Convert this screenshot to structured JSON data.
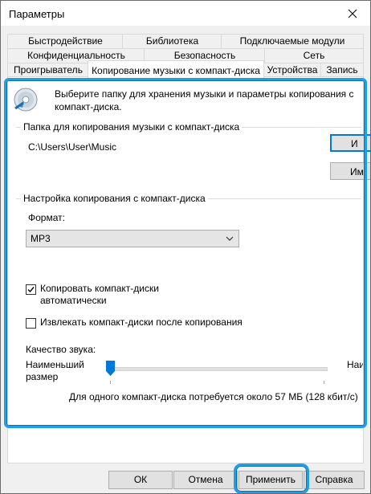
{
  "window": {
    "title": "Параметры"
  },
  "tabs": {
    "row1": [
      "Быстродействие",
      "Библиотека",
      "Подключаемые модули"
    ],
    "row2": [
      "Конфиденциальность",
      "Безопасность",
      "Сеть"
    ],
    "row3": [
      "Проигрыватель",
      "Копирование музыки с компакт-диска",
      "Устройства",
      "Запись"
    ],
    "selected": "Копирование музыки с компакт-диска"
  },
  "intro": {
    "text": "Выберите папку для хранения музыки и параметры копирования с компакт-диска."
  },
  "folder_group": {
    "label": "Папка для копирования музыки с компакт-диска",
    "path": "C:\\Users\\User\\Music",
    "change_button": "И",
    "filename_button": "Им"
  },
  "rip_group": {
    "label": "Настройка копирования с компакт-диска",
    "format_label": "Формат:",
    "format_value": "MP3",
    "auto_rip": {
      "label": "Копировать компакт-диски автоматически",
      "checked": true
    },
    "eject": {
      "label": "Извлекать компакт-диски после копирования",
      "checked": false
    },
    "quality_label": "Качество звука:",
    "slider_left": "Наименьший размер",
    "slider_right": "Наилучшее качество",
    "slider_level": 0,
    "size_info": "Для одного компакт-диска потребуется около  57 МБ (128 кбит/с)"
  },
  "buttons": {
    "ok": "ОК",
    "cancel": "Отмена",
    "apply": "Применить",
    "help": "Справка"
  },
  "colors": {
    "highlight": "#1ea0e6",
    "focus": "#0078d7"
  }
}
